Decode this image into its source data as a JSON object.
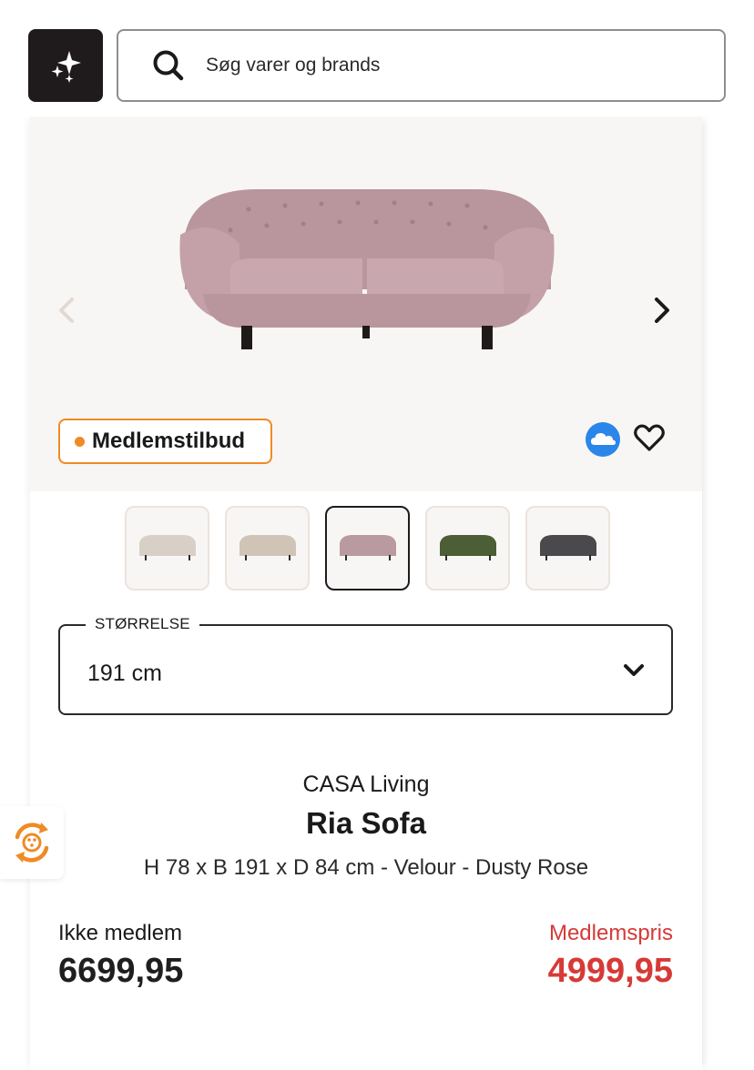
{
  "header": {
    "search_placeholder": "Søg varer og brands"
  },
  "gallery": {
    "badge_label": "Medlemstilbud",
    "thumbnail_colors": [
      "Beige",
      "Beige tufted",
      "Dusty Rose",
      "Green",
      "Dark Grey"
    ],
    "selected_index": 2
  },
  "size": {
    "legend": "STØRRELSE",
    "value": "191 cm"
  },
  "product": {
    "brand": "CASA Living",
    "name": "Ria Sofa",
    "description": "H 78 x B 191 x D 84 cm - Velour - Dusty Rose"
  },
  "pricing": {
    "regular_label": "Ikke medlem",
    "regular_price": "6699,95",
    "member_label": "Medlemspris",
    "member_price": "4999,95"
  },
  "colors": {
    "accent_orange": "#f08a24",
    "member_red": "#d63a37",
    "dark": "#1f1b1c",
    "hero_bg": "#f8f6f5"
  }
}
